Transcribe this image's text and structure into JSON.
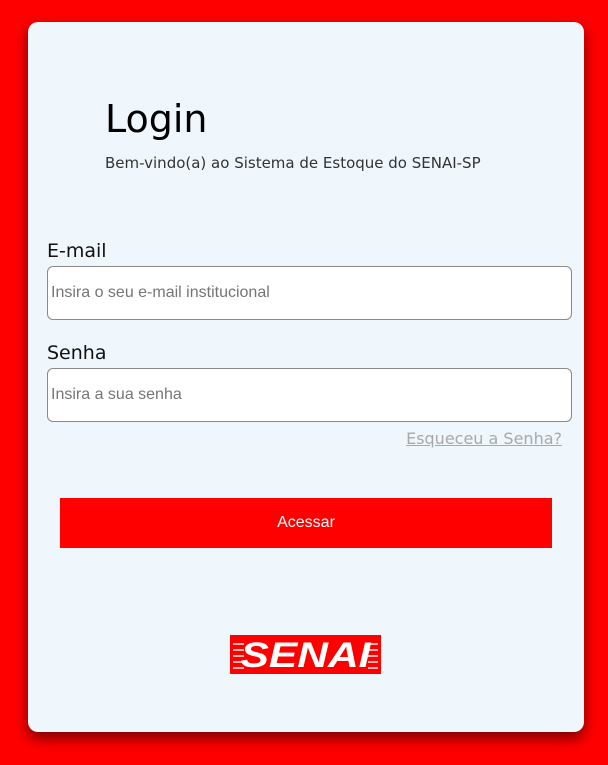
{
  "login": {
    "title": "Login",
    "subtitle": "Bem-vindo(a) ao Sistema de Estoque do SENAI-SP",
    "email_label": "E-mail",
    "email_placeholder": "Insira o seu e-mail institucional",
    "email_value": "",
    "password_label": "Senha",
    "password_placeholder": "Insira a sua senha",
    "password_value": "",
    "forgot_link": "Esqueceu a Senha?",
    "submit_label": "Acessar"
  },
  "logo": {
    "text": "SENAI",
    "name": "senai-logo"
  },
  "colors": {
    "background": "#ff0000",
    "card": "#eff7fd",
    "accent": "#ff0000",
    "link": "#a8a8a8"
  }
}
